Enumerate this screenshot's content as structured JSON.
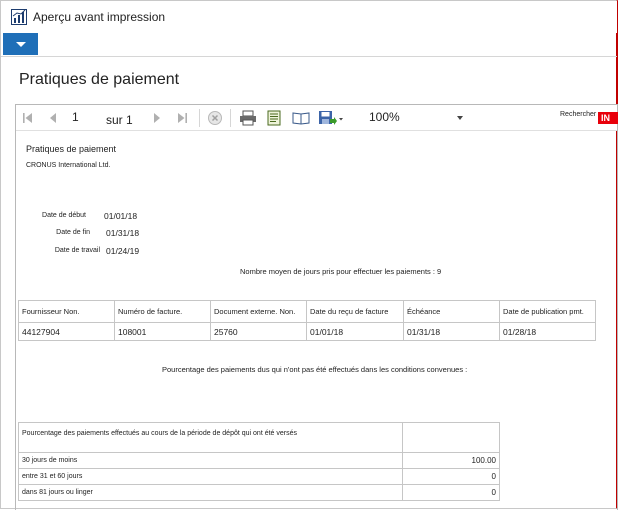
{
  "window": {
    "title": "Aperçu avant impression",
    "app_icon": "report-chart-icon",
    "accent_color": "#1f6fb8"
  },
  "page": {
    "title": "Pratiques de paiement"
  },
  "toolbar": {
    "page_value": "1",
    "of_label": "sur 1",
    "zoom": "100%",
    "search_label": "Rechercher",
    "search_button": "IN"
  },
  "report": {
    "title": "Pratiques de paiement",
    "company": "CRONUS International Ltd.",
    "start_label": "Date de début",
    "start_value": "01/01/18",
    "end_label": "Date de fin",
    "end_value": "01/31/18",
    "work_label": "Date de travail",
    "work_value": "01/24/19",
    "avg_days_note": "Nombre moyen de jours pris pour effectuer les paiements : 9",
    "payments_table": {
      "headers": [
        "Fournisseur Non.",
        "Numéro de facture.",
        "Document externe. Non.",
        "Date du reçu de facture",
        "Échéance",
        "Date de publication pmt."
      ],
      "rows": [
        [
          "44127904",
          "108001",
          "25760",
          "01/01/18",
          "01/31/18",
          "01/28/18"
        ]
      ]
    },
    "unpaid_note": "Pourcentage des paiements dus qui n'ont pas été effectués dans les conditions convenues :",
    "period_table": {
      "header": "Pourcentage des paiements effectués au cours de la période de dépôt qui ont été versés",
      "rows": [
        {
          "label": "30 jours de moins",
          "value": "100.00"
        },
        {
          "label": "entre 31 et 60 jours",
          "value": "0"
        },
        {
          "label": "dans 81 jours ou linger",
          "value": "0"
        }
      ]
    }
  }
}
